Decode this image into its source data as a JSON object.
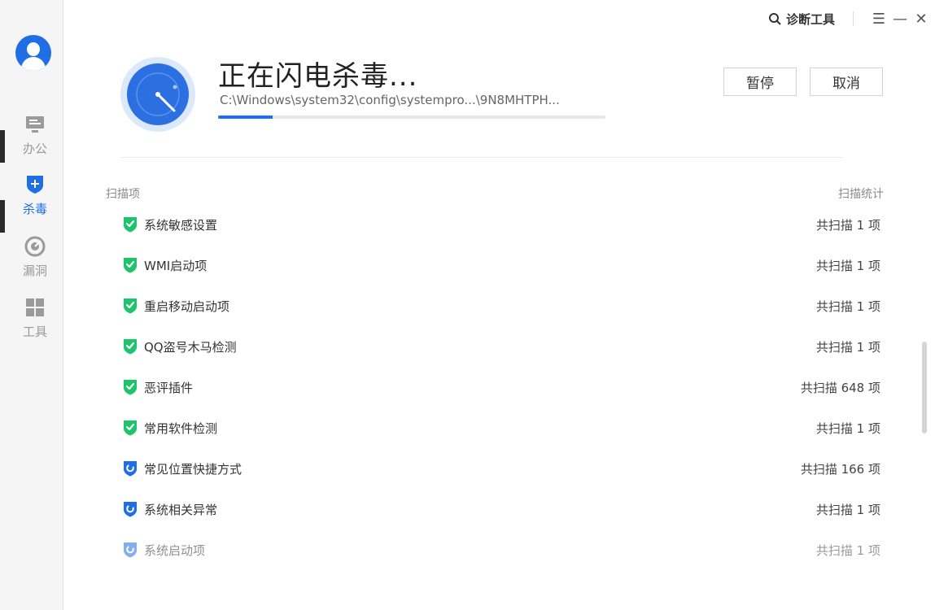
{
  "sidebar": {
    "items": [
      {
        "label": "办公",
        "icon": "monitor-icon"
      },
      {
        "label": "杀毒",
        "icon": "shield-plus-icon",
        "active": true
      },
      {
        "label": "漏洞",
        "icon": "radar-icon"
      },
      {
        "label": "工具",
        "icon": "grid-icon"
      }
    ]
  },
  "titlebar": {
    "diagnose_label": "诊断工具",
    "menu_glyph": "☰",
    "minimize_glyph": "—",
    "close_glyph": "✕"
  },
  "scan": {
    "title": "正在闪电杀毒...",
    "current_path": "C:\\Windows\\system32\\config\\systempro...\\9N8MHTPH...",
    "progress_percent": 14,
    "pause_label": "暂停",
    "cancel_label": "取消"
  },
  "list": {
    "col_item": "扫描项",
    "col_stat": "扫描统计",
    "rows": [
      {
        "name": "系统敏感设置",
        "stat": "共扫描 1 项",
        "status": "done"
      },
      {
        "name": "WMI启动项",
        "stat": "共扫描 1 项",
        "status": "done"
      },
      {
        "name": "重启移动启动项",
        "stat": "共扫描 1 项",
        "status": "done"
      },
      {
        "name": "QQ盗号木马检测",
        "stat": "共扫描 1 项",
        "status": "done"
      },
      {
        "name": "恶评插件",
        "stat": "共扫描 648 项",
        "status": "done"
      },
      {
        "name": "常用软件检测",
        "stat": "共扫描 1 项",
        "status": "done"
      },
      {
        "name": "常见位置快捷方式",
        "stat": "共扫描 166 项",
        "status": "scanning"
      },
      {
        "name": "系统相关异常",
        "stat": "共扫描 1 项",
        "status": "scanning"
      },
      {
        "name": "系统启动项",
        "stat": "共扫描 1 项",
        "status": "scanning-faded"
      }
    ]
  },
  "colors": {
    "accent": "#1f6ee6",
    "done_green": "#1cc46a"
  }
}
